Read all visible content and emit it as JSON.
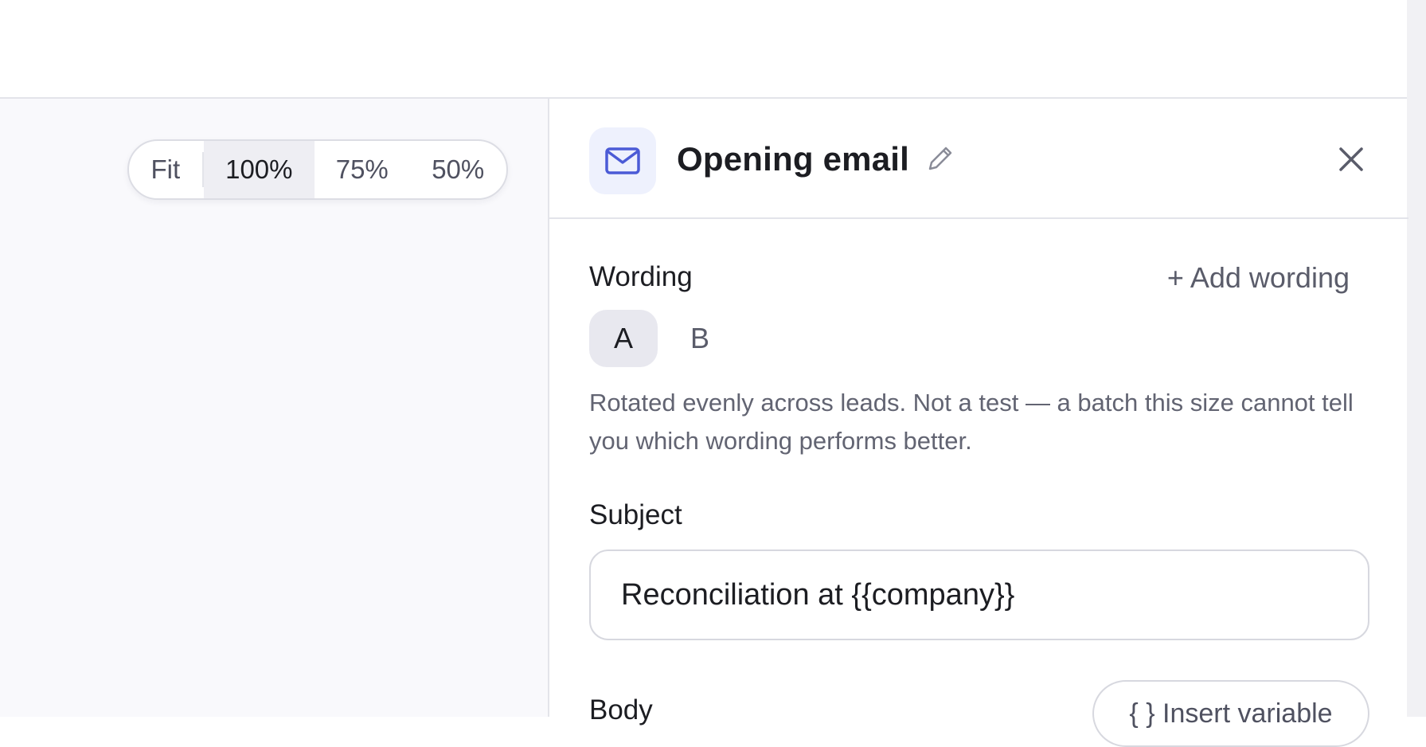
{
  "zoom": {
    "options": [
      "Fit",
      "100%",
      "75%",
      "50%"
    ],
    "selected": "100%"
  },
  "panel": {
    "title": "Opening email",
    "wording": {
      "label": "Wording",
      "add_label": "+ Add wording",
      "variants": [
        "A",
        "B"
      ],
      "selected_variant": "A",
      "helper": "Rotated evenly across leads. Not a test — a batch this size cannot tell you which wording performs better."
    },
    "subject": {
      "label": "Subject",
      "value": "Reconciliation at {{company}}"
    },
    "body": {
      "label": "Body",
      "insert_variable_label": "{ } Insert variable"
    }
  },
  "colors": {
    "accent": "#4b5bd6",
    "accent_bg": "#eef1fd",
    "border": "#e3e4ea"
  },
  "icons": {
    "header": "mail-icon",
    "edit": "pencil-icon",
    "close": "close-icon"
  }
}
